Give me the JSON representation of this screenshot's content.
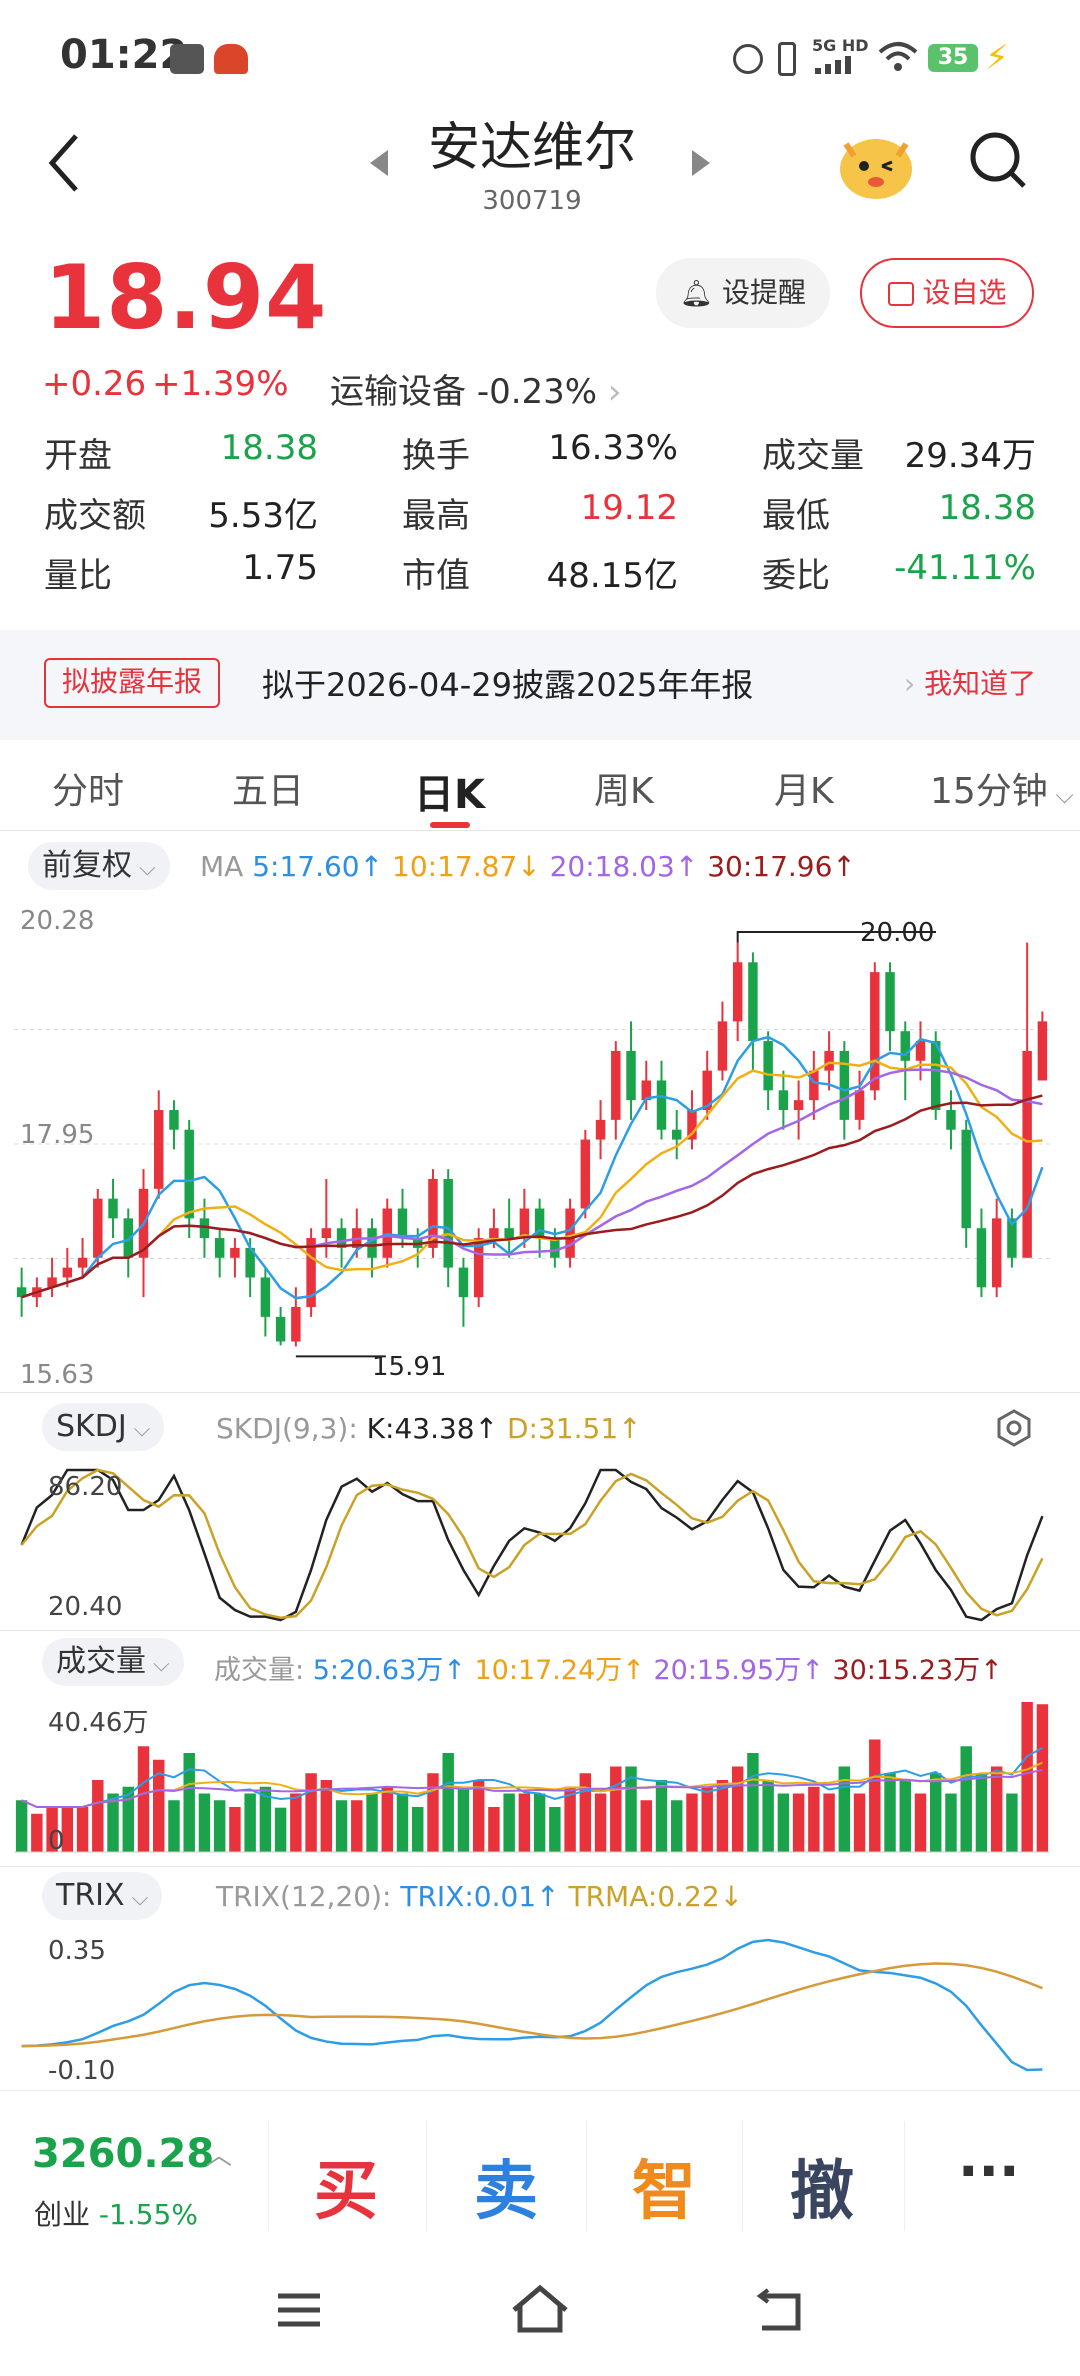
{
  "status": {
    "time": "01:22",
    "signal": "5G HD",
    "battery": "35"
  },
  "header": {
    "title": "安达维尔",
    "code": "300719"
  },
  "quote": {
    "price": "18.94",
    "change": "+0.26",
    "change_pct": "+1.39%",
    "sector": "运输设备",
    "sector_pct": "-0.23%",
    "alert_btn": "设提醒",
    "watch_btn": "设自选",
    "stats": [
      {
        "label": "开盘",
        "value": "18.38",
        "color": "green"
      },
      {
        "label": "换手",
        "value": "16.33%",
        "color": "dark"
      },
      {
        "label": "成交量",
        "value": "29.34万",
        "color": "dark"
      },
      {
        "label": "成交额",
        "value": "5.53亿",
        "color": "dark"
      },
      {
        "label": "最高",
        "value": "19.12",
        "color": "red"
      },
      {
        "label": "最低",
        "value": "18.38",
        "color": "green"
      },
      {
        "label": "量比",
        "value": "1.75",
        "color": "dark"
      },
      {
        "label": "市值",
        "value": "48.15亿",
        "color": "dark"
      },
      {
        "label": "委比",
        "value": "-41.11%",
        "color": "green"
      }
    ]
  },
  "banner": {
    "tag": "拟披露年报",
    "text": "拟于2026-04-29披露2025年年报",
    "action": "我知道了"
  },
  "tabs": [
    "分时",
    "五日",
    "日K",
    "周K",
    "月K",
    "15分钟"
  ],
  "active_tab": "日K",
  "main_chart": {
    "adjust": "前复权",
    "ma_label": "MA",
    "ma5": "5:17.60↑",
    "ma10": "10:17.87↓",
    "ma20": "20:18.03↑",
    "ma30": "30:17.96↑",
    "ymax": "20.28",
    "ymid": "17.95",
    "ymin": "15.63",
    "hi_mark": "20.00",
    "lo_mark": "15.91"
  },
  "skdj": {
    "name": "SKDJ",
    "params": "SKDJ(9,3):",
    "k": "K:43.38↑",
    "d": "D:31.51↑",
    "ymax": "86.20",
    "ymin": "20.40"
  },
  "volume": {
    "name": "成交量",
    "label": "成交量:",
    "v5": "5:20.63万↑",
    "v10": "10:17.24万↑",
    "v20": "20:15.95万↑",
    "v30": "30:15.23万↑",
    "ymax": "40.46万",
    "ymin": "0"
  },
  "trix": {
    "name": "TRIX",
    "params": "TRIX(12,20):",
    "trix": "TRIX:0.01↑",
    "trma": "TRMA:0.22↓",
    "ymax": "0.35",
    "ymin": "-0.10"
  },
  "bottom": {
    "index_value": "3260.28",
    "index_name": "创业",
    "index_pct": "-1.55%",
    "buy": "买",
    "sell": "卖",
    "smart": "智",
    "cancel": "撤",
    "more": "···"
  },
  "chart_data": {
    "type": "candlestick",
    "title": "",
    "ylim": [
      15.63,
      20.28
    ],
    "candles": [
      [
        16.5,
        16.4,
        16.7,
        16.2
      ],
      [
        16.4,
        16.5,
        16.6,
        16.3
      ],
      [
        16.5,
        16.6,
        16.8,
        16.4
      ],
      [
        16.6,
        16.7,
        16.9,
        16.5
      ],
      [
        16.7,
        16.8,
        17.0,
        16.6
      ],
      [
        16.8,
        17.4,
        17.5,
        16.7
      ],
      [
        17.4,
        17.2,
        17.6,
        17.0
      ],
      [
        17.2,
        16.8,
        17.3,
        16.6
      ],
      [
        16.8,
        17.5,
        17.7,
        16.4
      ],
      [
        17.5,
        18.3,
        18.5,
        17.4
      ],
      [
        18.3,
        18.1,
        18.4,
        17.9
      ],
      [
        18.1,
        17.2,
        18.2,
        17.0
      ],
      [
        17.2,
        17.0,
        17.4,
        16.8
      ],
      [
        17.0,
        16.8,
        17.1,
        16.6
      ],
      [
        16.8,
        16.9,
        17.0,
        16.6
      ],
      [
        16.9,
        16.6,
        17.0,
        16.4
      ],
      [
        16.6,
        16.2,
        16.7,
        16.0
      ],
      [
        16.2,
        15.95,
        16.3,
        15.91
      ],
      [
        15.95,
        16.3,
        16.5,
        15.9
      ],
      [
        16.3,
        17.0,
        17.1,
        16.2
      ],
      [
        17.0,
        17.1,
        17.6,
        16.8
      ],
      [
        17.1,
        16.9,
        17.2,
        16.7
      ],
      [
        16.9,
        17.1,
        17.3,
        16.8
      ],
      [
        17.1,
        16.8,
        17.2,
        16.6
      ],
      [
        16.8,
        17.3,
        17.4,
        16.7
      ],
      [
        17.3,
        17.0,
        17.5,
        16.9
      ],
      [
        17.0,
        16.9,
        17.1,
        16.7
      ],
      [
        16.9,
        17.6,
        17.7,
        16.8
      ],
      [
        17.6,
        16.7,
        17.7,
        16.5
      ],
      [
        16.7,
        16.4,
        16.8,
        16.1
      ],
      [
        16.4,
        17.0,
        17.1,
        16.3
      ],
      [
        17.0,
        17.1,
        17.3,
        16.9
      ],
      [
        17.1,
        17.0,
        17.4,
        16.8
      ],
      [
        17.0,
        17.3,
        17.5,
        16.9
      ],
      [
        17.3,
        17.0,
        17.4,
        16.8
      ],
      [
        17.0,
        16.8,
        17.1,
        16.7
      ],
      [
        16.8,
        17.3,
        17.4,
        16.7
      ],
      [
        17.3,
        18.0,
        18.1,
        17.2
      ],
      [
        18.0,
        18.2,
        18.4,
        17.8
      ],
      [
        18.2,
        18.9,
        19.0,
        18.0
      ],
      [
        18.9,
        18.4,
        19.2,
        18.2
      ],
      [
        18.4,
        18.6,
        18.8,
        18.3
      ],
      [
        18.6,
        18.1,
        18.8,
        18.0
      ],
      [
        18.1,
        18.0,
        18.3,
        17.8
      ],
      [
        18.0,
        18.3,
        18.5,
        17.9
      ],
      [
        18.3,
        18.7,
        18.9,
        18.2
      ],
      [
        18.7,
        19.2,
        19.4,
        18.6
      ],
      [
        19.2,
        19.8,
        20.0,
        19.0
      ],
      [
        19.8,
        19.0,
        19.9,
        18.7
      ],
      [
        19.0,
        18.5,
        19.1,
        18.3
      ],
      [
        18.5,
        18.3,
        18.7,
        18.1
      ],
      [
        18.3,
        18.4,
        18.6,
        18.0
      ],
      [
        18.4,
        18.7,
        18.9,
        18.2
      ],
      [
        18.7,
        18.9,
        19.1,
        18.5
      ],
      [
        18.9,
        18.2,
        19.0,
        18.0
      ],
      [
        18.2,
        18.5,
        18.7,
        18.1
      ],
      [
        18.5,
        19.7,
        19.8,
        18.4
      ],
      [
        19.7,
        19.1,
        19.8,
        18.9
      ],
      [
        19.1,
        18.8,
        19.2,
        18.4
      ],
      [
        18.8,
        19.0,
        19.2,
        18.6
      ],
      [
        19.0,
        18.3,
        19.1,
        18.2
      ],
      [
        18.3,
        18.1,
        18.5,
        17.9
      ],
      [
        18.1,
        17.1,
        18.2,
        16.9
      ],
      [
        17.1,
        16.5,
        17.3,
        16.4
      ],
      [
        16.5,
        17.2,
        17.4,
        16.4
      ],
      [
        17.2,
        16.8,
        17.3,
        16.7
      ],
      [
        16.8,
        18.9,
        20.0,
        16.8
      ],
      [
        18.6,
        19.2,
        19.3,
        18.6
      ]
    ]
  }
}
